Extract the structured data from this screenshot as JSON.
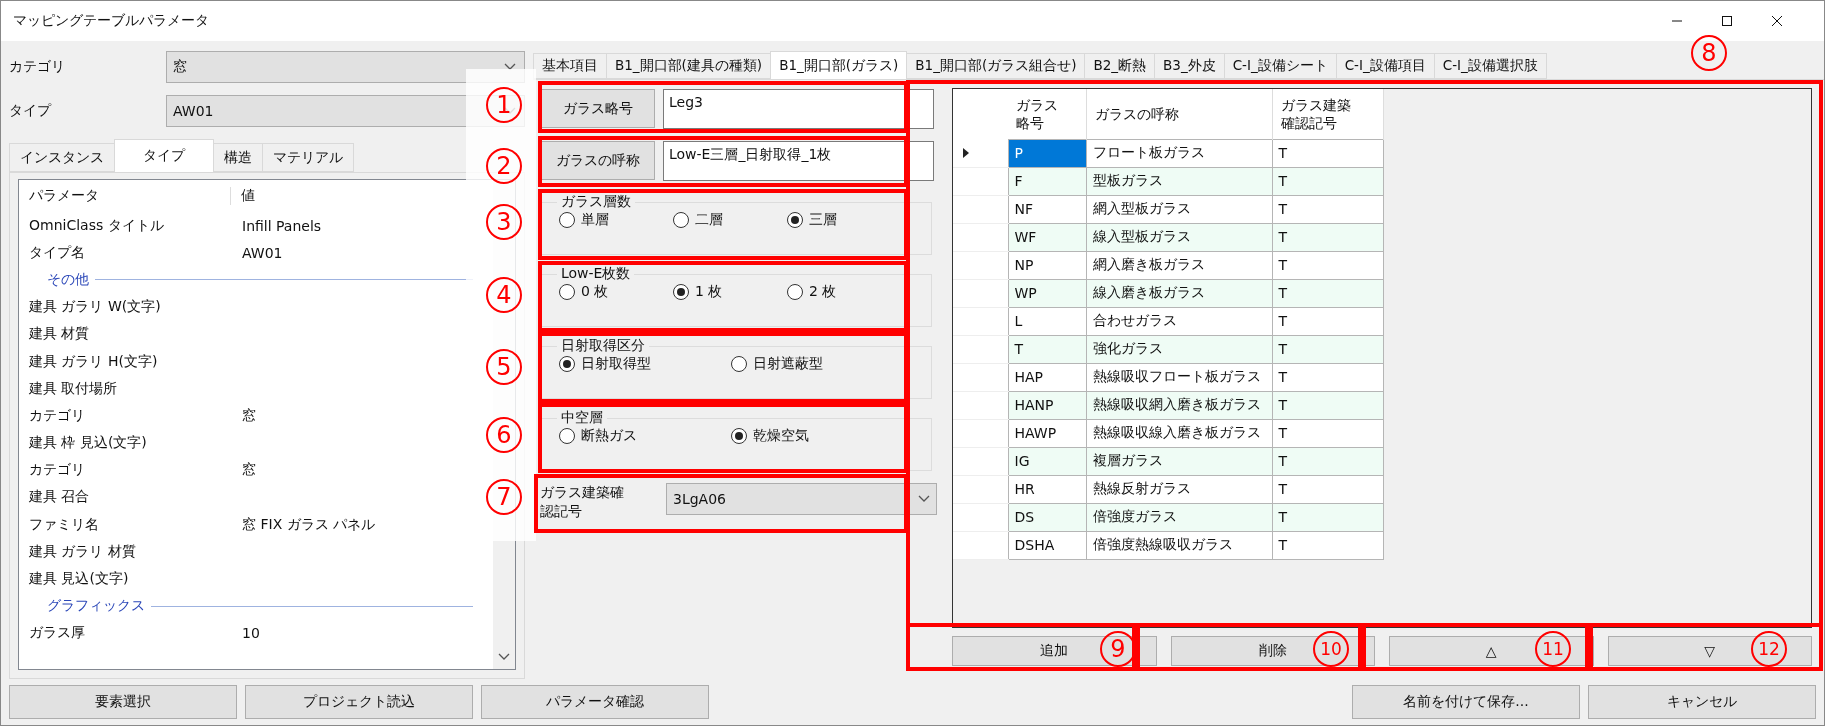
{
  "window": {
    "title": "マッピングテーブルパラメータ"
  },
  "left": {
    "fields": [
      {
        "label": "カテゴリ",
        "value": "窓"
      },
      {
        "label": "タイプ",
        "value": "AW01"
      }
    ],
    "tabs": [
      {
        "label": "インスタンス",
        "selected": false
      },
      {
        "label": "タイプ",
        "selected": true
      },
      {
        "label": "構造",
        "selected": false
      },
      {
        "label": "マテリアル",
        "selected": false
      }
    ],
    "grid": {
      "columns": [
        "パラメータ",
        "値"
      ],
      "rows": [
        {
          "kind": "row",
          "name": "OmniClass タイトル",
          "value": "Infill Panels"
        },
        {
          "kind": "row",
          "name": "タイプ名",
          "value": "AW01"
        },
        {
          "kind": "group",
          "name": "その他"
        },
        {
          "kind": "row",
          "name": "建具 ガラリ W(文字)"
        },
        {
          "kind": "row",
          "name": "建具 材質"
        },
        {
          "kind": "row",
          "name": "建具 ガラリ H(文字)"
        },
        {
          "kind": "row",
          "name": "建具 取付場所"
        },
        {
          "kind": "row",
          "name": "カテゴリ",
          "value": "窓"
        },
        {
          "kind": "row",
          "name": "建具 枠 見込(文字)"
        },
        {
          "kind": "row",
          "name": "カテゴリ",
          "value": "窓"
        },
        {
          "kind": "row",
          "name": "建具 召合"
        },
        {
          "kind": "row",
          "name": "ファミリ名",
          "value": "窓 FIX ガラス パネル"
        },
        {
          "kind": "row",
          "name": "建具 ガラリ 材質"
        },
        {
          "kind": "row",
          "name": "建具 見込(文字)"
        },
        {
          "kind": "group",
          "name": "グラフィックス"
        },
        {
          "kind": "row",
          "name": "ガラス厚",
          "value": "10"
        }
      ]
    }
  },
  "tabs": [
    {
      "label": "基本項目",
      "selected": false
    },
    {
      "label": "B1_開口部(建具の種類)",
      "selected": false
    },
    {
      "label": "B1_開口部(ガラス)",
      "selected": true
    },
    {
      "label": "B1_開口部(ガラス組合せ)",
      "selected": false
    },
    {
      "label": "B2_断熱",
      "selected": false
    },
    {
      "label": "B3_外皮",
      "selected": false
    },
    {
      "label": "C-I_設備シート",
      "selected": false
    },
    {
      "label": "C-I_設備項目",
      "selected": false
    },
    {
      "label": "C-I_設備選択肢",
      "selected": false
    }
  ],
  "form": {
    "fields": [
      {
        "button": "ガラス略号",
        "value": "Leg3"
      },
      {
        "button": "ガラスの呼称",
        "value": "Low-E三層_日射取得_1枚"
      }
    ],
    "groups": [
      {
        "title": "ガラス層数",
        "options": [
          {
            "label": "単層",
            "selected": false
          },
          {
            "label": "二層",
            "selected": false
          },
          {
            "label": "三層",
            "selected": true
          }
        ]
      },
      {
        "title": "Low-E枚数",
        "options": [
          {
            "label": "0 枚",
            "selected": false
          },
          {
            "label": "1 枚",
            "selected": true
          },
          {
            "label": "2 枚",
            "selected": false
          }
        ]
      },
      {
        "title": "日射取得区分",
        "options": [
          {
            "label": "日射取得型",
            "selected": true
          },
          {
            "label": "日射遮蔽型",
            "selected": false
          }
        ]
      },
      {
        "title": "中空層",
        "options": [
          {
            "label": "断熱ガス",
            "selected": false
          },
          {
            "label": "乾燥空気",
            "selected": true
          }
        ]
      }
    ],
    "cert": {
      "label": "ガラス建築確認記号",
      "value": "3LgA06"
    }
  },
  "table": {
    "columns": [
      "ガラス略号",
      "ガラスの呼称",
      "ガラス建築確認記号"
    ],
    "rows": [
      {
        "code": "P",
        "name": "フロート板ガラス",
        "cert": "T",
        "selected": true
      },
      {
        "code": "F",
        "name": "型板ガラス",
        "cert": "T",
        "selected": false
      },
      {
        "code": "NF",
        "name": "網入型板ガラス",
        "cert": "T",
        "selected": false
      },
      {
        "code": "WF",
        "name": "線入型板ガラス",
        "cert": "T",
        "selected": false
      },
      {
        "code": "NP",
        "name": "網入磨き板ガラス",
        "cert": "T",
        "selected": false
      },
      {
        "code": "WP",
        "name": "線入磨き板ガラス",
        "cert": "T",
        "selected": false
      },
      {
        "code": "L",
        "name": "合わせガラス",
        "cert": "T",
        "selected": false
      },
      {
        "code": "T",
        "name": "強化ガラス",
        "cert": "T",
        "selected": false
      },
      {
        "code": "HAP",
        "name": "熱線吸収フロート板ガラス",
        "cert": "T",
        "selected": false
      },
      {
        "code": "HANP",
        "name": "熱線吸収網入磨き板ガラス",
        "cert": "T",
        "selected": false
      },
      {
        "code": "HAWP",
        "name": "熱線吸収線入磨き板ガラス",
        "cert": "T",
        "selected": false
      },
      {
        "code": "IG",
        "name": "複層ガラス",
        "cert": "T",
        "selected": false
      },
      {
        "code": "HR",
        "name": "熱線反射ガラス",
        "cert": "T",
        "selected": false
      },
      {
        "code": "DS",
        "name": "倍強度ガラス",
        "cert": "T",
        "selected": false
      },
      {
        "code": "DSHA",
        "name": "倍強度熱線吸収ガラス",
        "cert": "T",
        "selected": false
      }
    ],
    "buttons": [
      "追加",
      "削除",
      "△",
      "▽"
    ]
  },
  "footer": {
    "left": [
      "要素選択",
      "プロジェクト読込",
      "パラメータ確認"
    ],
    "right": [
      "名前を付けて保存...",
      "キャンセル"
    ]
  },
  "annotations": [
    "1",
    "2",
    "3",
    "4",
    "5",
    "6",
    "7",
    "8",
    "9",
    "10",
    "11",
    "12"
  ]
}
